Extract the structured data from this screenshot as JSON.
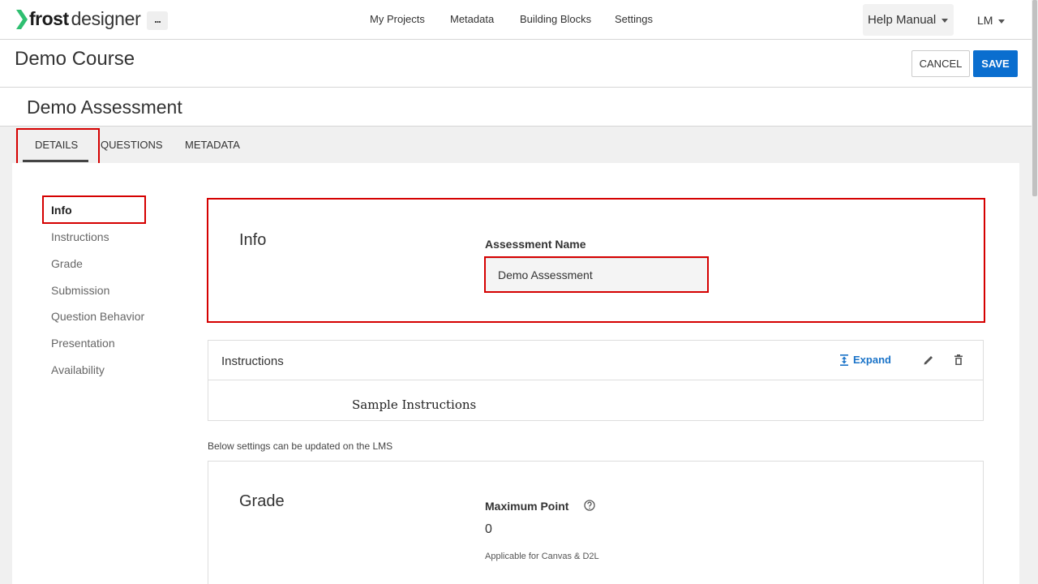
{
  "header": {
    "brand_bold": "frost",
    "brand_light": "designer",
    "more_label": "...",
    "nav": [
      "My Projects",
      "Metadata",
      "Building Blocks",
      "Settings"
    ],
    "help_label": "Help Manual",
    "user_label": "LM"
  },
  "course": {
    "title": "Demo Course",
    "cancel_label": "CANCEL",
    "save_label": "SAVE"
  },
  "assessment": {
    "title": "Demo Assessment",
    "tabs": [
      "DETAILS",
      "QUESTIONS",
      "METADATA"
    ],
    "active_tab": "DETAILS"
  },
  "sidebar": {
    "items": [
      "Info",
      "Instructions",
      "Grade",
      "Submission",
      "Question Behavior",
      "Presentation",
      "Availability"
    ],
    "active": "Info"
  },
  "info_card": {
    "heading": "Info",
    "field_label": "Assessment Name",
    "field_value": "Demo Assessment"
  },
  "instructions_card": {
    "title": "Instructions",
    "expand_label": "Expand",
    "body": "Sample Instructions"
  },
  "lms_note": "Below settings can be updated on the LMS",
  "grade_card": {
    "heading": "Grade",
    "field_label": "Maximum Point",
    "field_value": "0",
    "note": "Applicable for Canvas & D2L"
  },
  "colors": {
    "accent": "#0a6ecf",
    "highlight": "#d50000",
    "brand_green": "#2fbf71"
  }
}
